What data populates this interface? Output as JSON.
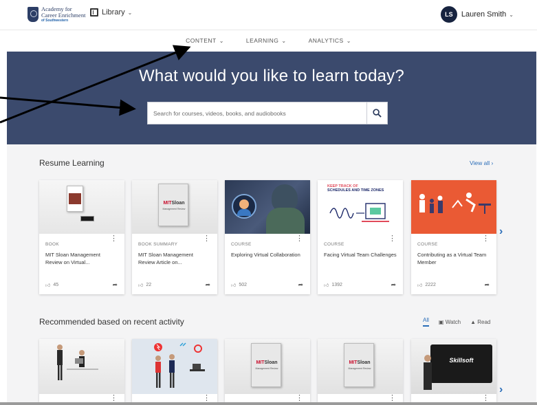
{
  "header": {
    "logo_line1": "Academy for",
    "logo_line2": "Career Enrichment",
    "logo_line3": "of Southwestern",
    "library_label": "Library",
    "user_initials": "LS",
    "user_name": "Lauren Smith"
  },
  "nav": {
    "items": [
      {
        "label": "CONTENT"
      },
      {
        "label": "LEARNING"
      },
      {
        "label": "ANALYTICS"
      }
    ]
  },
  "hero": {
    "title": "What would you like to learn today?",
    "search_placeholder": "Search for courses, videos, books, and audiobooks"
  },
  "resume": {
    "title": "Resume Learning",
    "view_all": "View all",
    "cards": [
      {
        "type": "BOOK",
        "title": "MIT Sloan Management Review on Virtual...",
        "likes": "45"
      },
      {
        "type": "BOOK SUMMARY",
        "title": "MIT Sloan Management Review Article on...",
        "likes": "22"
      },
      {
        "type": "COURSE",
        "title": "Exploring Virtual Collaboration",
        "likes": "502"
      },
      {
        "type": "COURSE",
        "title": "Facing Virtual Team Challenges",
        "likes": "1392"
      },
      {
        "type": "COURSE",
        "title": "Contributing as a Virtual Team Member",
        "likes": "2222"
      }
    ]
  },
  "recommended": {
    "title": "Recommended based on recent activity",
    "filters": [
      "All",
      "Watch",
      "Read"
    ]
  },
  "thumbs": {
    "mit_brand_red": "MIT",
    "mit_brand_rest": "Sloan",
    "mit_sub": "Management Review",
    "schedule_line1": "KEEP TRACK OF",
    "schedule_line2": "SCHEDULES AND TIME ZONES",
    "skillsoft": "Skillsoft"
  },
  "colors": {
    "hero_bg": "#3b4a6d",
    "accent": "#2a6db8",
    "avatar_bg": "#17233f"
  }
}
